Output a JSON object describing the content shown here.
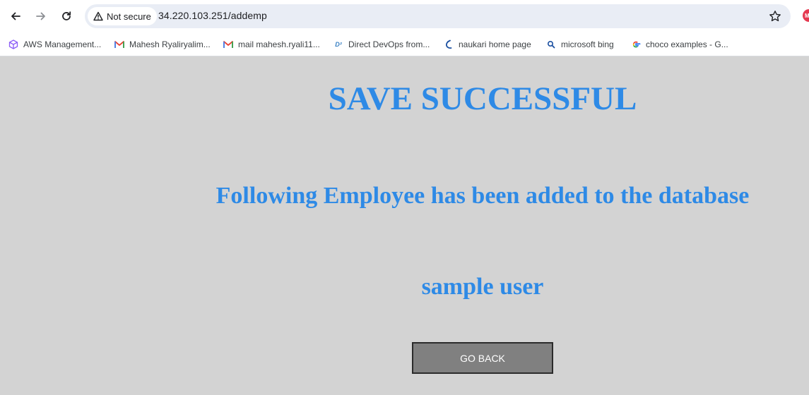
{
  "browser": {
    "security_label": "Not secure",
    "url": "34.220.103.251/addemp",
    "profile_initial": "M"
  },
  "bookmarks": [
    {
      "label": "AWS Management...",
      "icon": "aws-cube-icon"
    },
    {
      "label": "Mahesh Ryaliryalim...",
      "icon": "gmail-icon"
    },
    {
      "label": "mail mahesh.ryali11...",
      "icon": "gmail-icon"
    },
    {
      "label": "Direct DevOps from...",
      "icon": "devops-icon"
    },
    {
      "label": "naukari home page",
      "icon": "naukri-icon"
    },
    {
      "label": "microsoft bing",
      "icon": "bing-search-icon"
    },
    {
      "label": "choco examples - G...",
      "icon": "google-icon"
    }
  ],
  "page": {
    "heading": "SAVE SUCCESSFUL",
    "subheading": "Following Employee has been added to the database",
    "employee_name": "sample user",
    "go_back_label": "GO BACK"
  },
  "colors": {
    "page_background": "#d3d3d3",
    "heading_blue": "#2e8ae6",
    "button_gray": "#808080"
  }
}
